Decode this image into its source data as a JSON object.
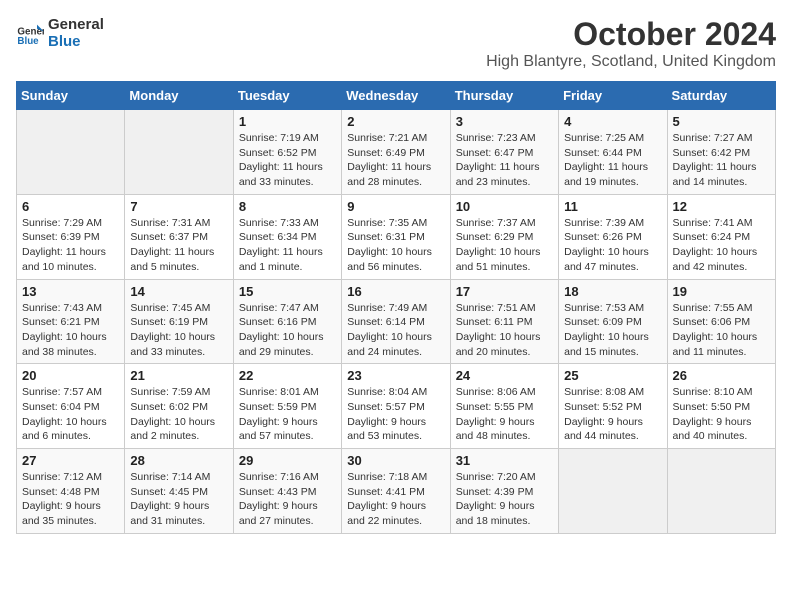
{
  "logo": {
    "line1": "General",
    "line2": "Blue"
  },
  "title": "October 2024",
  "location": "High Blantyre, Scotland, United Kingdom",
  "headers": [
    "Sunday",
    "Monday",
    "Tuesday",
    "Wednesday",
    "Thursday",
    "Friday",
    "Saturday"
  ],
  "weeks": [
    [
      {
        "day": "",
        "info": ""
      },
      {
        "day": "",
        "info": ""
      },
      {
        "day": "1",
        "info": "Sunrise: 7:19 AM\nSunset: 6:52 PM\nDaylight: 11 hours and 33 minutes."
      },
      {
        "day": "2",
        "info": "Sunrise: 7:21 AM\nSunset: 6:49 PM\nDaylight: 11 hours and 28 minutes."
      },
      {
        "day": "3",
        "info": "Sunrise: 7:23 AM\nSunset: 6:47 PM\nDaylight: 11 hours and 23 minutes."
      },
      {
        "day": "4",
        "info": "Sunrise: 7:25 AM\nSunset: 6:44 PM\nDaylight: 11 hours and 19 minutes."
      },
      {
        "day": "5",
        "info": "Sunrise: 7:27 AM\nSunset: 6:42 PM\nDaylight: 11 hours and 14 minutes."
      }
    ],
    [
      {
        "day": "6",
        "info": "Sunrise: 7:29 AM\nSunset: 6:39 PM\nDaylight: 11 hours and 10 minutes."
      },
      {
        "day": "7",
        "info": "Sunrise: 7:31 AM\nSunset: 6:37 PM\nDaylight: 11 hours and 5 minutes."
      },
      {
        "day": "8",
        "info": "Sunrise: 7:33 AM\nSunset: 6:34 PM\nDaylight: 11 hours and 1 minute."
      },
      {
        "day": "9",
        "info": "Sunrise: 7:35 AM\nSunset: 6:31 PM\nDaylight: 10 hours and 56 minutes."
      },
      {
        "day": "10",
        "info": "Sunrise: 7:37 AM\nSunset: 6:29 PM\nDaylight: 10 hours and 51 minutes."
      },
      {
        "day": "11",
        "info": "Sunrise: 7:39 AM\nSunset: 6:26 PM\nDaylight: 10 hours and 47 minutes."
      },
      {
        "day": "12",
        "info": "Sunrise: 7:41 AM\nSunset: 6:24 PM\nDaylight: 10 hours and 42 minutes."
      }
    ],
    [
      {
        "day": "13",
        "info": "Sunrise: 7:43 AM\nSunset: 6:21 PM\nDaylight: 10 hours and 38 minutes."
      },
      {
        "day": "14",
        "info": "Sunrise: 7:45 AM\nSunset: 6:19 PM\nDaylight: 10 hours and 33 minutes."
      },
      {
        "day": "15",
        "info": "Sunrise: 7:47 AM\nSunset: 6:16 PM\nDaylight: 10 hours and 29 minutes."
      },
      {
        "day": "16",
        "info": "Sunrise: 7:49 AM\nSunset: 6:14 PM\nDaylight: 10 hours and 24 minutes."
      },
      {
        "day": "17",
        "info": "Sunrise: 7:51 AM\nSunset: 6:11 PM\nDaylight: 10 hours and 20 minutes."
      },
      {
        "day": "18",
        "info": "Sunrise: 7:53 AM\nSunset: 6:09 PM\nDaylight: 10 hours and 15 minutes."
      },
      {
        "day": "19",
        "info": "Sunrise: 7:55 AM\nSunset: 6:06 PM\nDaylight: 10 hours and 11 minutes."
      }
    ],
    [
      {
        "day": "20",
        "info": "Sunrise: 7:57 AM\nSunset: 6:04 PM\nDaylight: 10 hours and 6 minutes."
      },
      {
        "day": "21",
        "info": "Sunrise: 7:59 AM\nSunset: 6:02 PM\nDaylight: 10 hours and 2 minutes."
      },
      {
        "day": "22",
        "info": "Sunrise: 8:01 AM\nSunset: 5:59 PM\nDaylight: 9 hours and 57 minutes."
      },
      {
        "day": "23",
        "info": "Sunrise: 8:04 AM\nSunset: 5:57 PM\nDaylight: 9 hours and 53 minutes."
      },
      {
        "day": "24",
        "info": "Sunrise: 8:06 AM\nSunset: 5:55 PM\nDaylight: 9 hours and 48 minutes."
      },
      {
        "day": "25",
        "info": "Sunrise: 8:08 AM\nSunset: 5:52 PM\nDaylight: 9 hours and 44 minutes."
      },
      {
        "day": "26",
        "info": "Sunrise: 8:10 AM\nSunset: 5:50 PM\nDaylight: 9 hours and 40 minutes."
      }
    ],
    [
      {
        "day": "27",
        "info": "Sunrise: 7:12 AM\nSunset: 4:48 PM\nDaylight: 9 hours and 35 minutes."
      },
      {
        "day": "28",
        "info": "Sunrise: 7:14 AM\nSunset: 4:45 PM\nDaylight: 9 hours and 31 minutes."
      },
      {
        "day": "29",
        "info": "Sunrise: 7:16 AM\nSunset: 4:43 PM\nDaylight: 9 hours and 27 minutes."
      },
      {
        "day": "30",
        "info": "Sunrise: 7:18 AM\nSunset: 4:41 PM\nDaylight: 9 hours and 22 minutes."
      },
      {
        "day": "31",
        "info": "Sunrise: 7:20 AM\nSunset: 4:39 PM\nDaylight: 9 hours and 18 minutes."
      },
      {
        "day": "",
        "info": ""
      },
      {
        "day": "",
        "info": ""
      }
    ]
  ]
}
